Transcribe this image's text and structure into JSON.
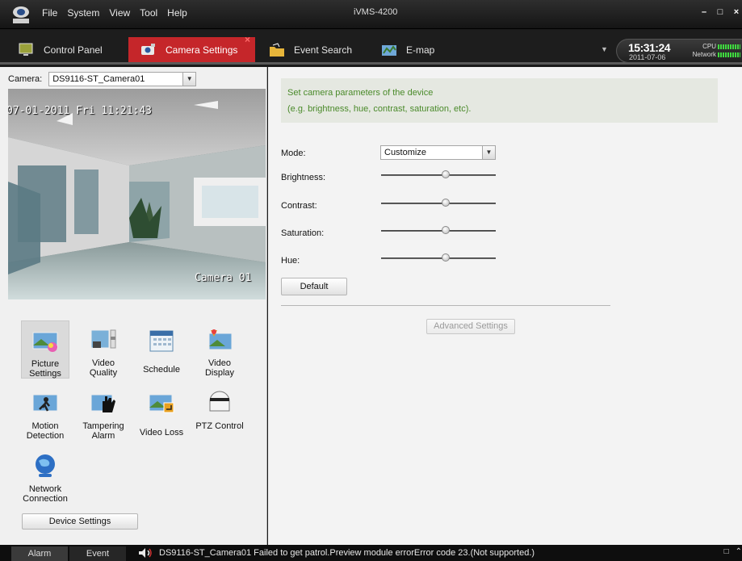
{
  "app": {
    "title": "iVMS-4200",
    "menu": [
      "File",
      "System",
      "View",
      "Tool",
      "Help"
    ]
  },
  "tabs": [
    {
      "label": "Control Panel",
      "icon": "monitor-icon",
      "active": false
    },
    {
      "label": "Camera Settings",
      "icon": "camera-settings-icon",
      "active": true
    },
    {
      "label": "Event Search",
      "icon": "folder-icon",
      "active": false
    },
    {
      "label": "E-map",
      "icon": "map-icon",
      "active": false
    }
  ],
  "clock": {
    "time": "15:31:24",
    "date": "2011-07-06",
    "cpu_label": "CPU",
    "network_label": "Network"
  },
  "camera": {
    "label": "Camera:",
    "selected": "DS9116-ST_Camera01",
    "osd_time": "07-01-2011 Fri 11:21:43",
    "osd_name": "Camera 01"
  },
  "functions": [
    {
      "label": "Picture Settings",
      "icon": "picture-settings-icon",
      "selected": true
    },
    {
      "label": "Video Quality",
      "icon": "video-quality-icon",
      "selected": false
    },
    {
      "label": "Schedule",
      "icon": "schedule-icon",
      "selected": false
    },
    {
      "label": "Video Display",
      "icon": "video-display-icon",
      "selected": false
    },
    {
      "label": "Motion Detection",
      "icon": "motion-detection-icon",
      "selected": false
    },
    {
      "label": "Tampering Alarm",
      "icon": "tampering-alarm-icon",
      "selected": false
    },
    {
      "label": "Video Loss",
      "icon": "video-loss-icon",
      "selected": false
    },
    {
      "label": "PTZ Control",
      "icon": "ptz-control-icon",
      "selected": false
    },
    {
      "label": "Network Connection",
      "icon": "network-connection-icon",
      "selected": false
    }
  ],
  "device_settings_button": "Device Settings",
  "picture_settings": {
    "info_line1": "Set camera parameters of the device",
    "info_line2": "(e.g. brightness, hue, contrast, saturation, etc).",
    "mode_label": "Mode:",
    "mode_value": "Customize",
    "sliders": [
      {
        "label": "Brightness:",
        "value": 0.56
      },
      {
        "label": "Contrast:",
        "value": 0.56
      },
      {
        "label": "Saturation:",
        "value": 0.56
      },
      {
        "label": "Hue:",
        "value": 0.56
      }
    ],
    "default_button": "Default",
    "advanced_button": "Advanced Settings"
  },
  "status": {
    "alarm_tab": "Alarm",
    "event_tab": "Event",
    "message": "DS9116-ST_Camera01 Failed to get patrol.Preview module errorError code 23.(Not supported.)"
  },
  "colors": {
    "accent": "#c5262a",
    "info_text": "#4a8a2a"
  }
}
